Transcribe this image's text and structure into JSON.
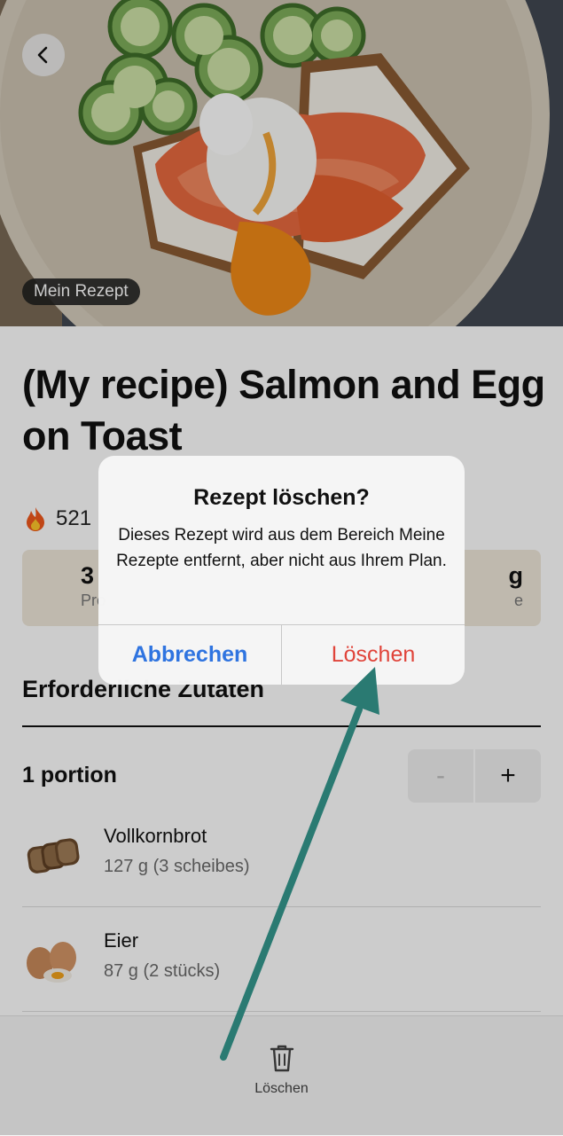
{
  "hero": {
    "badge": "Mein Rezept"
  },
  "recipe": {
    "title": "(My recipe) Salmon and Egg on Toast",
    "calories_visible": "521",
    "macros_left": {
      "value": "3",
      "label": "Pro"
    },
    "macros_right": {
      "value": "g",
      "label": "e"
    }
  },
  "ingredients": {
    "heading": "Erforderliche Zutaten",
    "portion_label": "1 portion",
    "stepper": {
      "minus": "-",
      "plus": "+"
    },
    "items": [
      {
        "name": "Vollkornbrot",
        "qty": "127 g (3 scheibes)"
      },
      {
        "name": "Eier",
        "qty": "87 g (2 stücks)"
      }
    ]
  },
  "bottom_bar": {
    "delete_label": "Löschen"
  },
  "dialog": {
    "title": "Rezept löschen?",
    "message": "Dieses Rezept wird aus dem Bereich Meine Rezepte entfernt, aber nicht aus Ihrem Plan.",
    "cancel_label": "Abbrechen",
    "delete_label": "Löschen"
  },
  "colors": {
    "cancel_blue": "#2f74e0",
    "delete_red": "#e0443a",
    "arrow_teal": "#2a7a72",
    "macro_bg": "#efe8da"
  }
}
